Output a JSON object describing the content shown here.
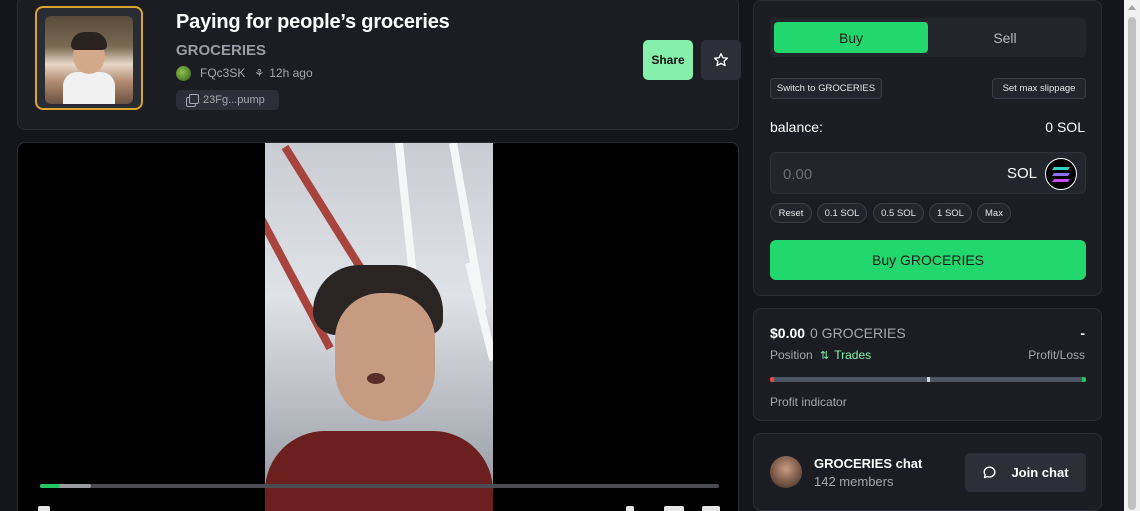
{
  "header": {
    "title": "Paying for people’s groceries",
    "ticker": "GROCERIES",
    "creator": "FQc3SK",
    "age": "12h ago",
    "contract_short": "23Fg...pump",
    "share_label": "Share",
    "star_icon": "star-icon"
  },
  "video": {
    "progress": 0.03,
    "buffered": 0.075
  },
  "trade": {
    "tabs": [
      {
        "label": "Buy",
        "active": true
      },
      {
        "label": "Sell",
        "active": false
      }
    ],
    "switch_label": "Switch to GROCERIES",
    "slippage_label": "Set max slippage",
    "balance_label": "balance:",
    "balance_value": "0 SOL",
    "amount_placeholder": "0.00",
    "amount_unit": "SOL",
    "quick_amounts": [
      "Reset",
      "0.1 SOL",
      "0.5 SOL",
      "1 SOL",
      "Max"
    ],
    "buy_button": "Buy GROCERIES",
    "accent": "#22d86e"
  },
  "position": {
    "usd": "$0.00",
    "tokens": "0 GROCERIES",
    "pnl": "-",
    "position_label": "Position",
    "trades_label": "Trades",
    "pnl_label": "Profit/Loss",
    "indicator_label": "Profit indicator"
  },
  "chat": {
    "name": "GROCERIES chat",
    "members": "142 members",
    "join_label": "Join chat"
  }
}
